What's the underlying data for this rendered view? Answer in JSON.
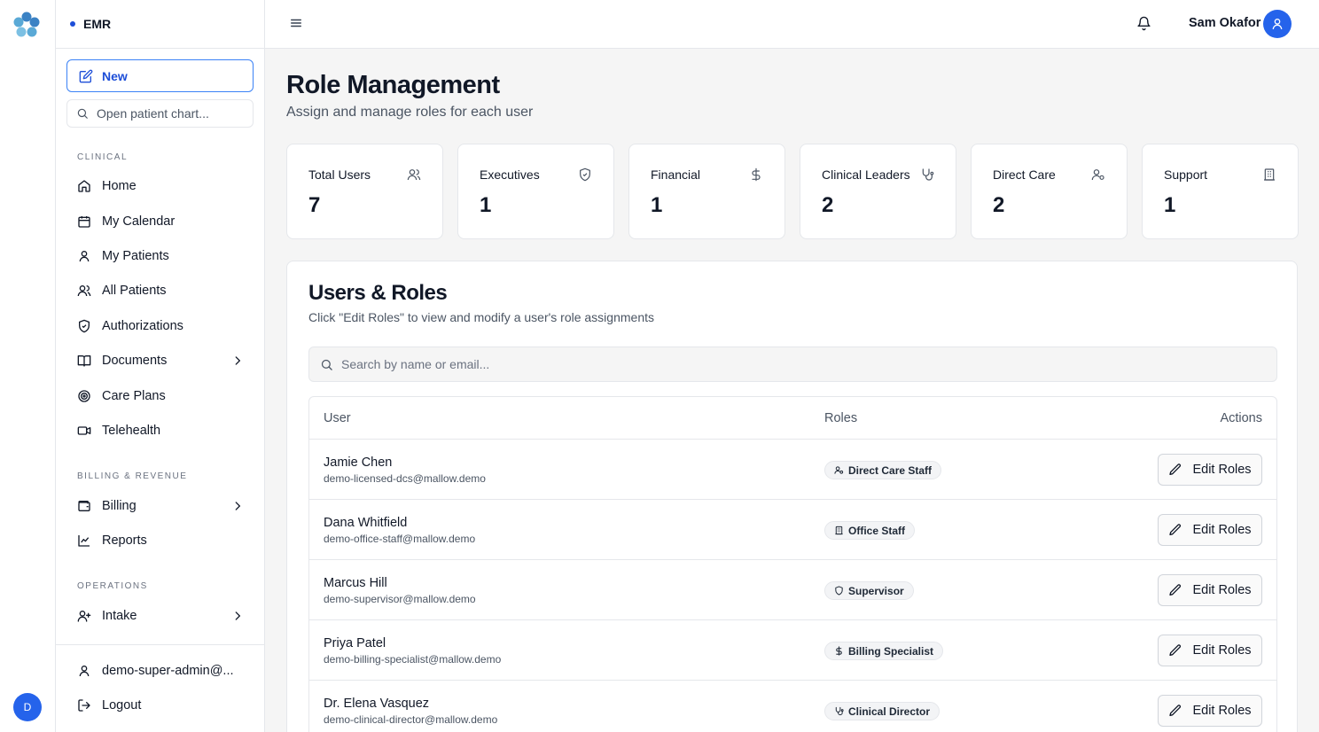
{
  "app": {
    "brand": "EMR"
  },
  "rail": {
    "avatar_initial": "D"
  },
  "sidebar": {
    "new_label": "New",
    "search_placeholder": "Open patient chart...",
    "sections": {
      "clinical": "CLINICAL",
      "billing": "BILLING & REVENUE",
      "operations": "OPERATIONS"
    },
    "items": [
      {
        "label": "Home",
        "icon": "home-icon"
      },
      {
        "label": "My Calendar",
        "icon": "calendar-icon"
      },
      {
        "label": "My Patients",
        "icon": "user-icon"
      },
      {
        "label": "All Patients",
        "icon": "users-icon"
      },
      {
        "label": "Authorizations",
        "icon": "shield-check-icon"
      },
      {
        "label": "Documents",
        "icon": "book-icon"
      },
      {
        "label": "Care Plans",
        "icon": "target-icon"
      },
      {
        "label": "Telehealth",
        "icon": "video-icon"
      },
      {
        "label": "Billing",
        "icon": "wallet-icon"
      },
      {
        "label": "Reports",
        "icon": "line-chart-icon"
      },
      {
        "label": "Intake",
        "icon": "user-plus-icon"
      }
    ],
    "account": "demo-super-admin@...",
    "logout": "Logout"
  },
  "topbar": {
    "user_name": "Sam Okafor"
  },
  "page": {
    "title": "Role Management",
    "subtitle": "Assign and manage roles for each user"
  },
  "stats": [
    {
      "label": "Total Users",
      "value": "7",
      "icon": "users-icon"
    },
    {
      "label": "Executives",
      "value": "1",
      "icon": "shield-icon"
    },
    {
      "label": "Financial",
      "value": "1",
      "icon": "dollar-icon"
    },
    {
      "label": "Clinical Leaders",
      "value": "2",
      "icon": "stethoscope-icon"
    },
    {
      "label": "Direct Care",
      "value": "2",
      "icon": "user-cog-icon"
    },
    {
      "label": "Support",
      "value": "1",
      "icon": "building-icon"
    }
  ],
  "panel": {
    "title": "Users & Roles",
    "subtitle": "Click \"Edit Roles\" to view and modify a user's role assignments",
    "search_placeholder": "Search by name or email...",
    "columns": {
      "user": "User",
      "roles": "Roles",
      "actions": "Actions"
    },
    "edit_label": "Edit Roles",
    "rows": [
      {
        "name": "Jamie Chen",
        "email": "demo-licensed-dcs@mallow.demo",
        "role": "Direct Care Staff",
        "role_icon": "user-cog-icon"
      },
      {
        "name": "Dana Whitfield",
        "email": "demo-office-staff@mallow.demo",
        "role": "Office Staff",
        "role_icon": "building-icon"
      },
      {
        "name": "Marcus Hill",
        "email": "demo-supervisor@mallow.demo",
        "role": "Supervisor",
        "role_icon": "shield-icon"
      },
      {
        "name": "Priya Patel",
        "email": "demo-billing-specialist@mallow.demo",
        "role": "Billing Specialist",
        "role_icon": "dollar-icon"
      },
      {
        "name": "Dr. Elena Vasquez",
        "email": "demo-clinical-director@mallow.demo",
        "role": "Clinical Director",
        "role_icon": "stethoscope-icon"
      }
    ]
  },
  "colors": {
    "accent": "#2563eb",
    "border": "#e5e7eb",
    "background": "#f5f5f5"
  }
}
